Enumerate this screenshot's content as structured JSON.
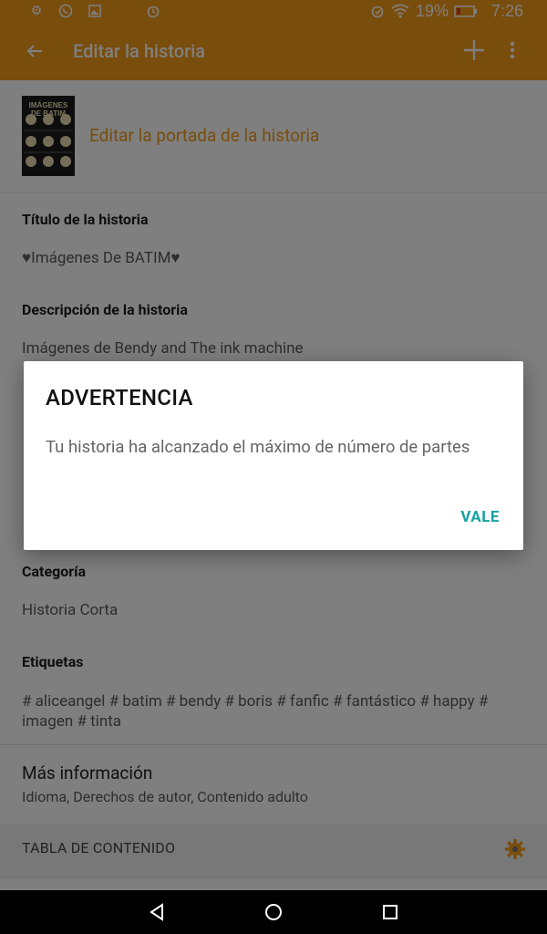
{
  "status_bar": {
    "battery": "19%",
    "time": "7:26",
    "icons": [
      "gear-icon",
      "whatsapp-icon",
      "image-icon",
      "alarm-icon",
      "alarm-clock-icon",
      "wifi-icon",
      "battery-icon"
    ]
  },
  "app_bar": {
    "title": "Editar la historia",
    "icons": [
      "back-arrow-icon",
      "add-icon",
      "more-vert-icon"
    ]
  },
  "cover": {
    "thumb_text": "IMÁGENES DE BATIM",
    "edit_label": "Editar la portada de la historia"
  },
  "fields": {
    "title_label": "Título de la historia",
    "title_value": "♥Imágenes De BATIM♥",
    "description_label": "Descripción de la historia",
    "description_value": "Imágenes de Bendy and The ink machine",
    "category_label": "Categoría",
    "category_value": "Historia Corta",
    "tags_label": "Etiquetas",
    "tags_value": "# aliceangel # batim # bendy # boris # fanfic # fantástico # happy # imagen # tinta"
  },
  "more_info": {
    "title": "Más información",
    "subtitle": "Idioma, Derechos de autor, Contenido adulto"
  },
  "toc": {
    "label": "TABLA DE CONTENIDO"
  },
  "dialog": {
    "title": "ADVERTENCIA",
    "message": "Tu historia ha alcanzado el máximo de número de partes",
    "ok_label": "VALE"
  },
  "colors": {
    "accent": "#f29a18",
    "dialog_button": "#14a2a2"
  }
}
